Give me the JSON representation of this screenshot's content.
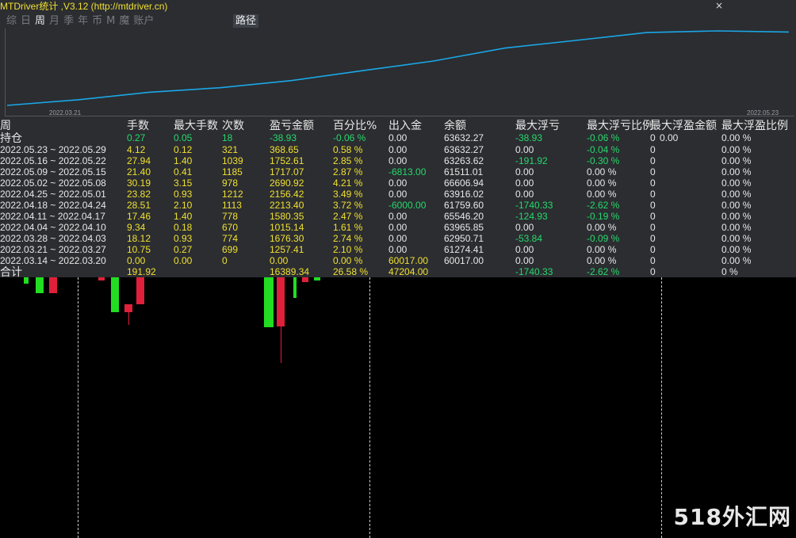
{
  "window": {
    "title": "MTDriver统计 ,V3.12 (http://mtdriver.cn)",
    "close": "×"
  },
  "tabs": [
    {
      "label": "综",
      "active": false
    },
    {
      "label": "日",
      "active": false
    },
    {
      "label": "周",
      "active": true
    },
    {
      "label": "月",
      "active": false
    },
    {
      "label": "季",
      "active": false
    },
    {
      "label": "年",
      "active": false
    },
    {
      "label": "币",
      "active": false
    },
    {
      "label": "M",
      "active": false
    },
    {
      "label": "魔",
      "active": false
    },
    {
      "label": "账户",
      "active": false
    }
  ],
  "route_tab": "路径",
  "chart_data": {
    "type": "line",
    "x": [
      "2022.03.21",
      "2022.03.28",
      "2022.04.04",
      "2022.04.11",
      "2022.04.18",
      "2022.04.25",
      "2022.05.02",
      "2022.05.09",
      "2022.05.16",
      "2022.05.23"
    ],
    "series": [
      {
        "values": [
          0,
          1257.41,
          2933.71,
          3949.15,
          5529.5,
          7742.93,
          9899.09,
          12789.99,
          14507.06,
          16259.67,
          16628.32,
          16389.34
        ]
      }
    ],
    "xtick_labels": [
      "2022.03.21",
      "2022.05.23"
    ],
    "color": "#1aa7e6"
  },
  "headers": [
    "周",
    "手数",
    "最大手数",
    "次数",
    "盈亏金额",
    "百分比%",
    "出入金",
    "余额",
    "最大浮亏",
    "最大浮亏比例",
    "最大浮盈金额",
    "最大浮盈比例"
  ],
  "holding": {
    "label": "持仓",
    "cells": [
      "0.27",
      "0.05",
      "18",
      "-38.93",
      "-0.06 %",
      "0.00",
      "63632.27",
      "-38.93",
      "-0.06 %",
      "0",
      "0.00",
      "0.00 %"
    ]
  },
  "rows": [
    {
      "label": "2022.05.23 ~ 2022.05.29",
      "cells": [
        "4.12",
        "0.12",
        "321",
        "368.65",
        "0.58 %",
        "0.00",
        "63632.27",
        "0.00",
        "-0.04 %",
        "0",
        "0.00 %"
      ]
    },
    {
      "label": "2022.05.16 ~ 2022.05.22",
      "cells": [
        "27.94",
        "1.40",
        "1039",
        "1752.61",
        "2.85 %",
        "0.00",
        "63263.62",
        "-191.92",
        "-0.30 %",
        "0",
        "0.00 %"
      ]
    },
    {
      "label": "2022.05.09 ~ 2022.05.15",
      "cells": [
        "21.40",
        "0.41",
        "1185",
        "1717.07",
        "2.87 %",
        "-6813.00",
        "61511.01",
        "0.00",
        "0.00 %",
        "0",
        "0.00 %"
      ]
    },
    {
      "label": "2022.05.02 ~ 2022.05.08",
      "cells": [
        "30.19",
        "3.15",
        "978",
        "2690.92",
        "4.21 %",
        "0.00",
        "66606.94",
        "0.00",
        "0.00 %",
        "0",
        "0.00 %"
      ]
    },
    {
      "label": "2022.04.25 ~ 2022.05.01",
      "cells": [
        "23.82",
        "0.93",
        "1212",
        "2156.42",
        "3.49 %",
        "0.00",
        "63916.02",
        "0.00",
        "0.00 %",
        "0",
        "0.00 %"
      ]
    },
    {
      "label": "2022.04.18 ~ 2022.04.24",
      "cells": [
        "28.51",
        "2.10",
        "1113",
        "2213.40",
        "3.72 %",
        "-6000.00",
        "61759.60",
        "-1740.33",
        "-2.62 %",
        "0",
        "0.00 %"
      ]
    },
    {
      "label": "2022.04.11 ~ 2022.04.17",
      "cells": [
        "17.46",
        "1.40",
        "778",
        "1580.35",
        "2.47 %",
        "0.00",
        "65546.20",
        "-124.93",
        "-0.19 %",
        "0",
        "0.00 %"
      ]
    },
    {
      "label": "2022.04.04 ~ 2022.04.10",
      "cells": [
        "9.34",
        "0.18",
        "670",
        "1015.14",
        "1.61 %",
        "0.00",
        "63965.85",
        "0.00",
        "0.00 %",
        "0",
        "0.00 %"
      ]
    },
    {
      "label": "2022.03.28 ~ 2022.04.03",
      "cells": [
        "18.12",
        "0.93",
        "774",
        "1676.30",
        "2.74 %",
        "0.00",
        "62950.71",
        "-53.84",
        "-0.09 %",
        "0",
        "0.00 %"
      ]
    },
    {
      "label": "2022.03.21 ~ 2022.03.27",
      "cells": [
        "10.75",
        "0.27",
        "699",
        "1257.41",
        "2.10 %",
        "0.00",
        "61274.41",
        "0.00",
        "0.00 %",
        "0",
        "0.00 %"
      ]
    },
    {
      "label": "2022.03.14 ~ 2022.03.20",
      "cells": [
        "0.00",
        "0.00",
        "0",
        "0.00",
        "0.00 %",
        "60017.00",
        "60017.00",
        "0.00",
        "0.00 %",
        "0",
        "0.00 %"
      ]
    }
  ],
  "total": {
    "label": "合计",
    "cells": [
      "191.92",
      "",
      "",
      "16389.34",
      "26.58 %",
      "47204.00",
      "",
      "-1740.33",
      "-2.62 %",
      "0",
      "0 %"
    ]
  },
  "watermark": "518外汇网"
}
